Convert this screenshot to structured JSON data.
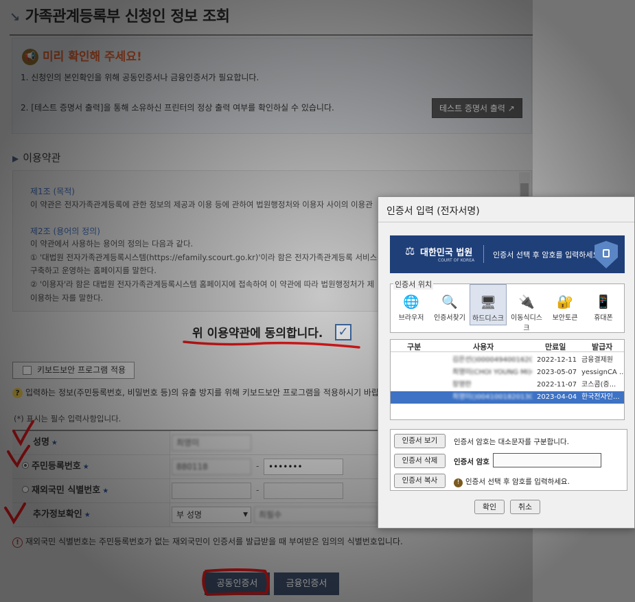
{
  "page": {
    "title": "가족관계등록부 신청인 정보 조회"
  },
  "notice": {
    "heading": "미리 확인해 주세요!",
    "line1": "1. 신청인의 본인확인을 위해 공동인증서나 금융인증서가 필요합니다.",
    "line2": "2. [테스트 증명서 출력]을 통해 소유하신 프린터의 정상 출력 여부를 확인하실 수 있습니다.",
    "test_button": "테스트 증명서 출력 ↗"
  },
  "terms": {
    "section_title": "이용약관",
    "art1_title": "제1조 (목적)",
    "art1_text": "이 약관은 전자가족관계등록에 관한 정보의 제공과 이용 등에 관하여 법원행정처와 이용자 사이의 이용관",
    "art2_title": "제2조 (용어의 정의)",
    "art2_text1": "이 약관에서 사용하는 용어의 정의는 다음과 같다.",
    "art2_text2": "① '대법원 전자가족관계등록시스템(https://efamily.scourt.go.kr)'이라 함은 전자가족관계등록 서비스를 인터넷",
    "art2_text3": "구축하고 운영하는 홈페이지를 말한다.",
    "art2_text4": "② '이용자'라 함은 대법원 전자가족관계등록시스템 홈페이지에 접속하여 이 약관에 따라 법원행정처가 제",
    "art2_text5": "이용하는 자를 말한다.",
    "agree_label": "위 이용약관에 동의합니다.",
    "agree_checked": true
  },
  "keyboard": {
    "button_label": "키보드보안 프로그램 적용",
    "info_text": "입력하는 정보(주민등록번호, 비밀번호 등)의 유출 방지를 위해 키보드보안 프로그램을 적용하시기 바랍니다."
  },
  "form": {
    "required_note": "(*) 표시는 필수 입력사항입니다.",
    "name_label": "성명",
    "name_value": "최영미",
    "rrn_label": "주민등록번호",
    "rrn_front": "880118",
    "rrn_back": "•••••••",
    "foreign_label": "재외국민 식별번호",
    "extra_label": "추가정보확인",
    "extra_select": "부 성명",
    "extra_value": "최필수",
    "dash": "-",
    "star": "★",
    "foreign_note": "재외국민 식별번호는 주민등록번호가 없는 재외국민이 인증서를 발급받을 때 부여받은 임의의 식별번호입니다."
  },
  "actions": {
    "public_cert": "공동인증서",
    "finance_cert": "금융인증서"
  },
  "dialog": {
    "title": "인증서 입력 (전자서명)",
    "banner_logo": "대한민국 법원",
    "banner_logo_sub": "COURT OF KOREA",
    "banner_msg": "인증서 선택 후 암호를 입력하세요.",
    "location_label": "인증서 위치",
    "locations": [
      "브라우저",
      "인증서찾기",
      "하드디스크",
      "이동식디스크",
      "보안토큰",
      "휴대폰"
    ],
    "selected_location": "하드디스크",
    "columns": [
      "구분",
      "사용자",
      "만료일",
      "발급자"
    ],
    "certs": [
      {
        "type": "은행개인",
        "user": "김은선()0000494001620591",
        "expiry": "2022-12-11",
        "issuer": "금융결제원"
      },
      {
        "type": "은행개인",
        "user": "최영미(CHOI YOUNG MI)0",
        "expiry": "2023-05-07",
        "issuer": "yessignCA ..."
      },
      {
        "type": "범용개인",
        "user": "장영란",
        "expiry": "2022-11-07",
        "issuer": "코스콤(증..."
      },
      {
        "type": "범용개인",
        "user": "최영미()0041001820130404...",
        "expiry": "2023-04-04",
        "issuer": "한국전자인..."
      }
    ],
    "selected_index": 3,
    "view_btn": "인증서 보기",
    "delete_btn": "인증서 삭제",
    "copy_btn": "인증서 복사",
    "case_note": "인증서 암호는 대소문자를 구분합니다.",
    "pw_label": "인증서 암호",
    "pw_hint": "인증서 선택 후 암호를 입력하세요.",
    "ok": "확인",
    "cancel": "취소"
  },
  "colors": {
    "accent_red": "#e0191b",
    "banner_blue": "#1f3f78",
    "selected_row": "#3d72c4",
    "primary_button": "#3d4d68"
  }
}
